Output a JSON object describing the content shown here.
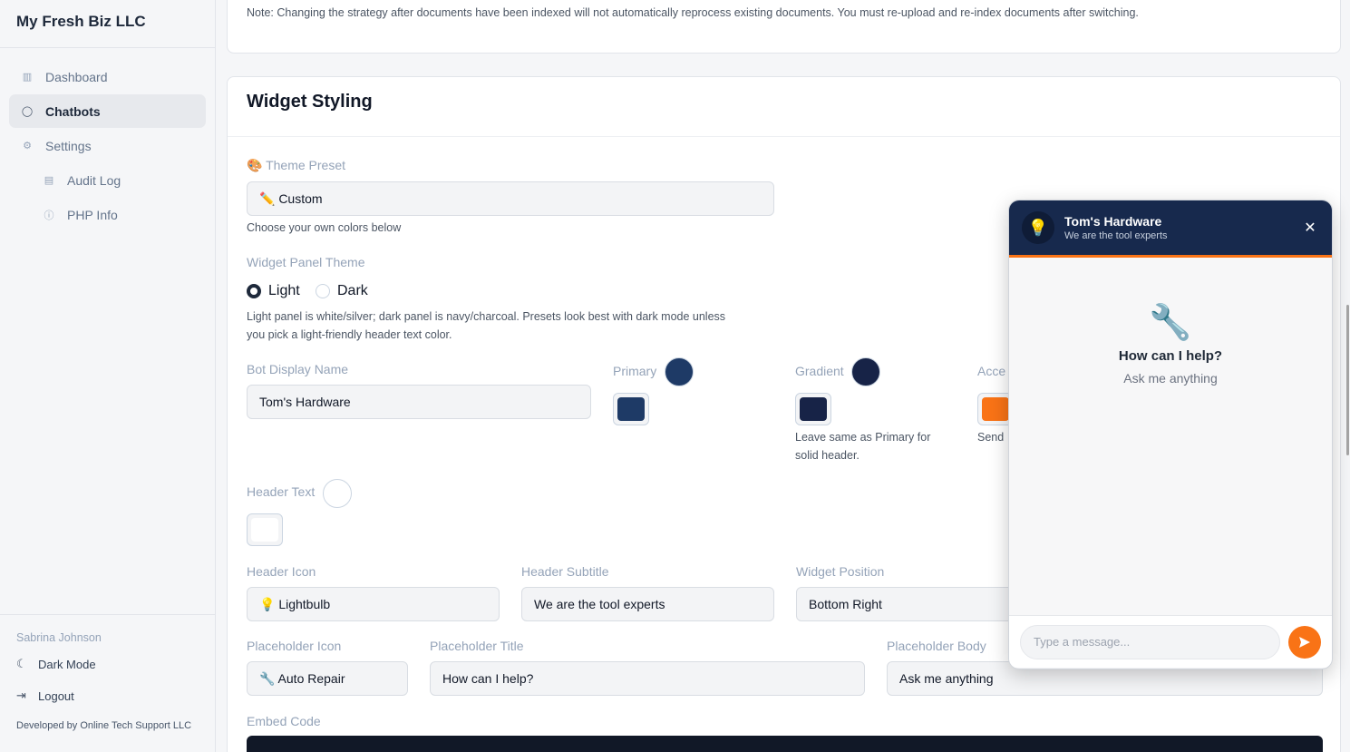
{
  "sidebar": {
    "brand": "My Fresh Biz LLC",
    "items": [
      {
        "label": "Dashboard",
        "icon": "bar-chart-icon"
      },
      {
        "label": "Chatbots",
        "icon": "chat-bubble-icon"
      },
      {
        "label": "Settings",
        "icon": "gear-icon"
      },
      {
        "label": "Audit Log",
        "icon": "document-icon"
      },
      {
        "label": "PHP Info",
        "icon": "info-icon"
      }
    ],
    "user_name": "Sabrina Johnson",
    "dark_mode_label": "Dark Mode",
    "logout_label": "Logout",
    "developer_credit": "Developed by Online Tech Support LLC"
  },
  "notice": {
    "text": "Note: Changing the strategy after documents have been indexed will not automatically reprocess existing documents. You must re-upload and re-index documents after switching."
  },
  "widget_styling": {
    "title": "Widget Styling",
    "theme_preset": {
      "label": "🎨 Theme Preset",
      "value": "✏️ Custom",
      "help": "Choose your own colors below"
    },
    "panel_theme": {
      "label": "Widget Panel Theme",
      "options": [
        "Light",
        "Dark"
      ],
      "selected": "Light",
      "help_line1": "Light panel is white/silver; dark panel is navy/charcoal. Presets look best with dark mode unless",
      "help_line2": "you pick a light-friendly header text color."
    },
    "bot_display_name": {
      "label": "Bot Display Name",
      "value": "Tom's Hardware"
    },
    "primary": {
      "label": "Primary",
      "color": "#1e3a66"
    },
    "gradient": {
      "label": "Gradient",
      "color": "#172347",
      "help_line1": "Leave same as Primary for",
      "help_line2": "solid header."
    },
    "accent": {
      "label": "Acce",
      "color": "#f97316",
      "help": "Send"
    },
    "header_text": {
      "label": "Header Text",
      "color": "#ffffff"
    },
    "header_icon": {
      "label": "Header Icon",
      "value": "💡 Lightbulb"
    },
    "header_subtitle": {
      "label": "Header Subtitle",
      "value": "We are the tool experts"
    },
    "widget_position": {
      "label": "Widget Position",
      "value": "Bottom Right"
    },
    "placeholder_icon": {
      "label": "Placeholder Icon",
      "value": "🔧 Auto Repair"
    },
    "placeholder_title": {
      "label": "Placeholder Title",
      "value": "How can I help?"
    },
    "placeholder_body": {
      "label": "Placeholder Body",
      "value": "Ask me anything"
    },
    "embed_code": {
      "label": "Embed Code"
    }
  },
  "chat_preview": {
    "title": "Tom's Hardware",
    "subtitle": "We are the tool experts",
    "header_icon": "💡",
    "close_symbol": "✕",
    "placeholder_icon": "🔧",
    "placeholder_title": "How can I help?",
    "placeholder_body": "Ask me anything",
    "input_placeholder": "Type a message...",
    "colors": {
      "header": "#17294d",
      "accent": "#f97316"
    }
  }
}
